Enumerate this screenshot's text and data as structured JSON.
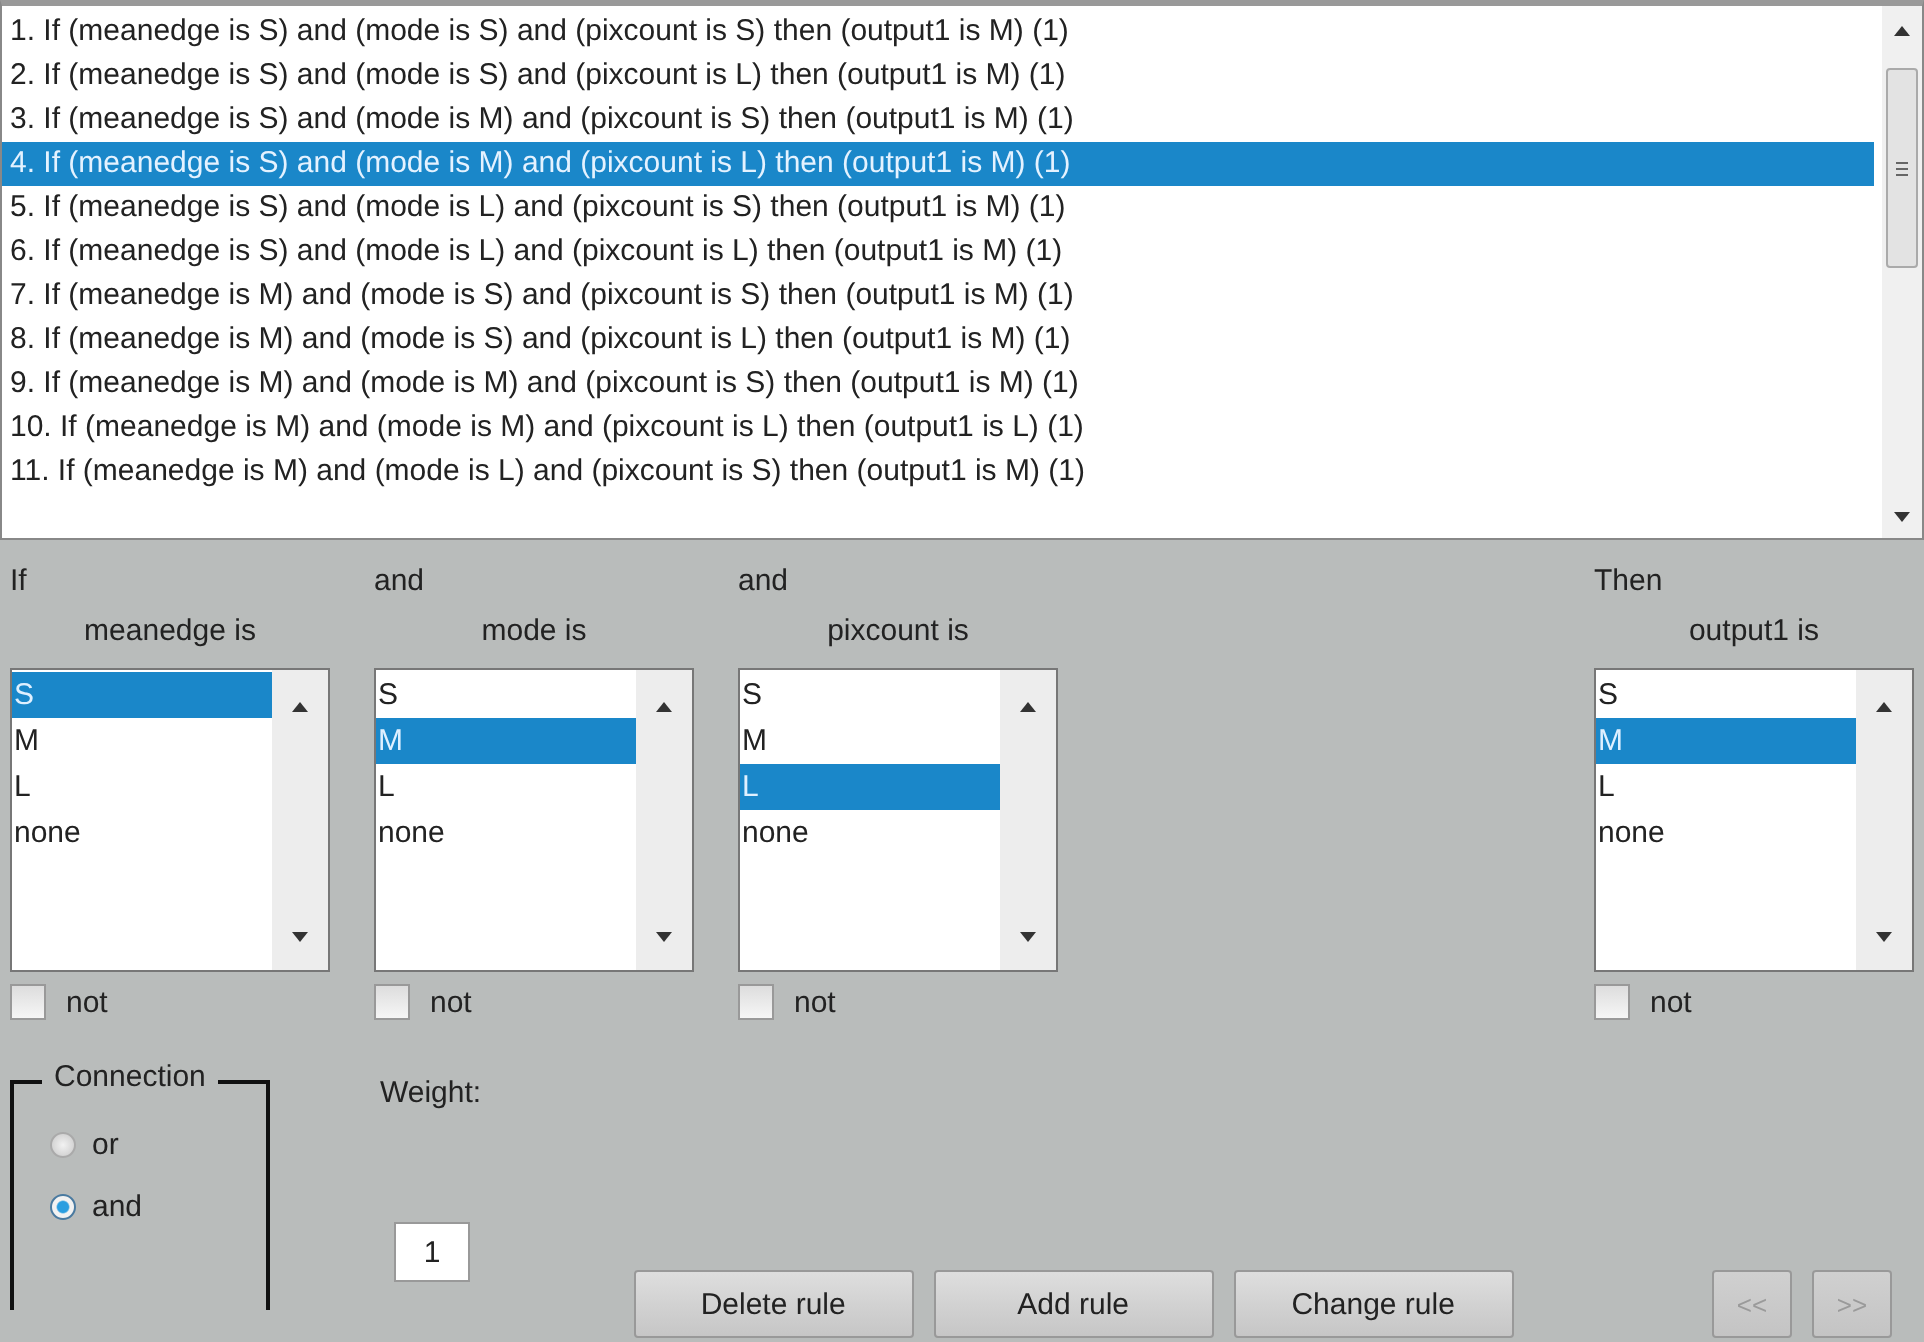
{
  "rules": [
    {
      "text": "1. If (meanedge is S) and (mode is S) and (pixcount is S) then (output1 is M) (1)",
      "selected": false
    },
    {
      "text": "2. If (meanedge is S) and (mode is S) and (pixcount is L) then (output1 is M) (1)",
      "selected": false
    },
    {
      "text": "3. If (meanedge is S) and (mode is M) and (pixcount is S) then (output1 is M) (1)",
      "selected": false
    },
    {
      "text": "4. If (meanedge is S) and (mode is M) and (pixcount is L) then (output1 is M) (1)",
      "selected": true
    },
    {
      "text": "5. If (meanedge is S) and (mode is L) and (pixcount is S) then (output1 is M) (1)",
      "selected": false
    },
    {
      "text": "6. If (meanedge is S) and (mode is L) and (pixcount is L) then (output1 is M) (1)",
      "selected": false
    },
    {
      "text": "7. If (meanedge is M) and (mode is S) and (pixcount is S) then (output1 is M) (1)",
      "selected": false
    },
    {
      "text": "8. If (meanedge is M) and (mode is S) and (pixcount is L) then (output1 is M) (1)",
      "selected": false
    },
    {
      "text": "9. If (meanedge is M) and (mode is M) and (pixcount is S) then (output1 is M) (1)",
      "selected": false
    },
    {
      "text": "10. If (meanedge is M) and (mode is M) and (pixcount is L) then (output1 is L) (1)",
      "selected": false
    },
    {
      "text": "11. If (meanedge is M) and (mode is L) and (pixcount is S) then (output1 is M) (1)",
      "selected": false
    }
  ],
  "variables": [
    {
      "kind": "input",
      "header": "If",
      "label": "meanedge is",
      "options": [
        {
          "label": "S",
          "selected": true
        },
        {
          "label": "M",
          "selected": false
        },
        {
          "label": "L",
          "selected": false
        },
        {
          "label": "none",
          "selected": false
        }
      ],
      "not": {
        "label": "not",
        "checked": false
      }
    },
    {
      "kind": "input",
      "header": "and",
      "label": "mode is",
      "options": [
        {
          "label": "S",
          "selected": false
        },
        {
          "label": "M",
          "selected": true
        },
        {
          "label": "L",
          "selected": false
        },
        {
          "label": "none",
          "selected": false
        }
      ],
      "not": {
        "label": "not",
        "checked": false
      }
    },
    {
      "kind": "input",
      "header": "and",
      "label": "pixcount is",
      "options": [
        {
          "label": "S",
          "selected": false
        },
        {
          "label": "M",
          "selected": false
        },
        {
          "label": "L",
          "selected": true
        },
        {
          "label": "none",
          "selected": false
        }
      ],
      "not": {
        "label": "not",
        "checked": false
      }
    },
    {
      "kind": "output",
      "header": "Then",
      "label": "output1 is",
      "options": [
        {
          "label": "S",
          "selected": false
        },
        {
          "label": "M",
          "selected": true
        },
        {
          "label": "L",
          "selected": false
        },
        {
          "label": "none",
          "selected": false
        }
      ],
      "not": {
        "label": "not",
        "checked": false
      }
    }
  ],
  "connection": {
    "title": "Connection",
    "options": [
      {
        "label": "or",
        "selected": false
      },
      {
        "label": "and",
        "selected": true
      }
    ]
  },
  "weight": {
    "label": "Weight:",
    "value": "1"
  },
  "buttons": [
    {
      "kind": "action",
      "label": "Delete rule",
      "disabled": false
    },
    {
      "kind": "action",
      "label": "Add rule",
      "disabled": false
    },
    {
      "kind": "action",
      "label": "Change rule",
      "disabled": false
    },
    {
      "kind": "nav",
      "label": "<<",
      "disabled": true
    },
    {
      "kind": "nav",
      "label": ">>",
      "disabled": true
    }
  ]
}
